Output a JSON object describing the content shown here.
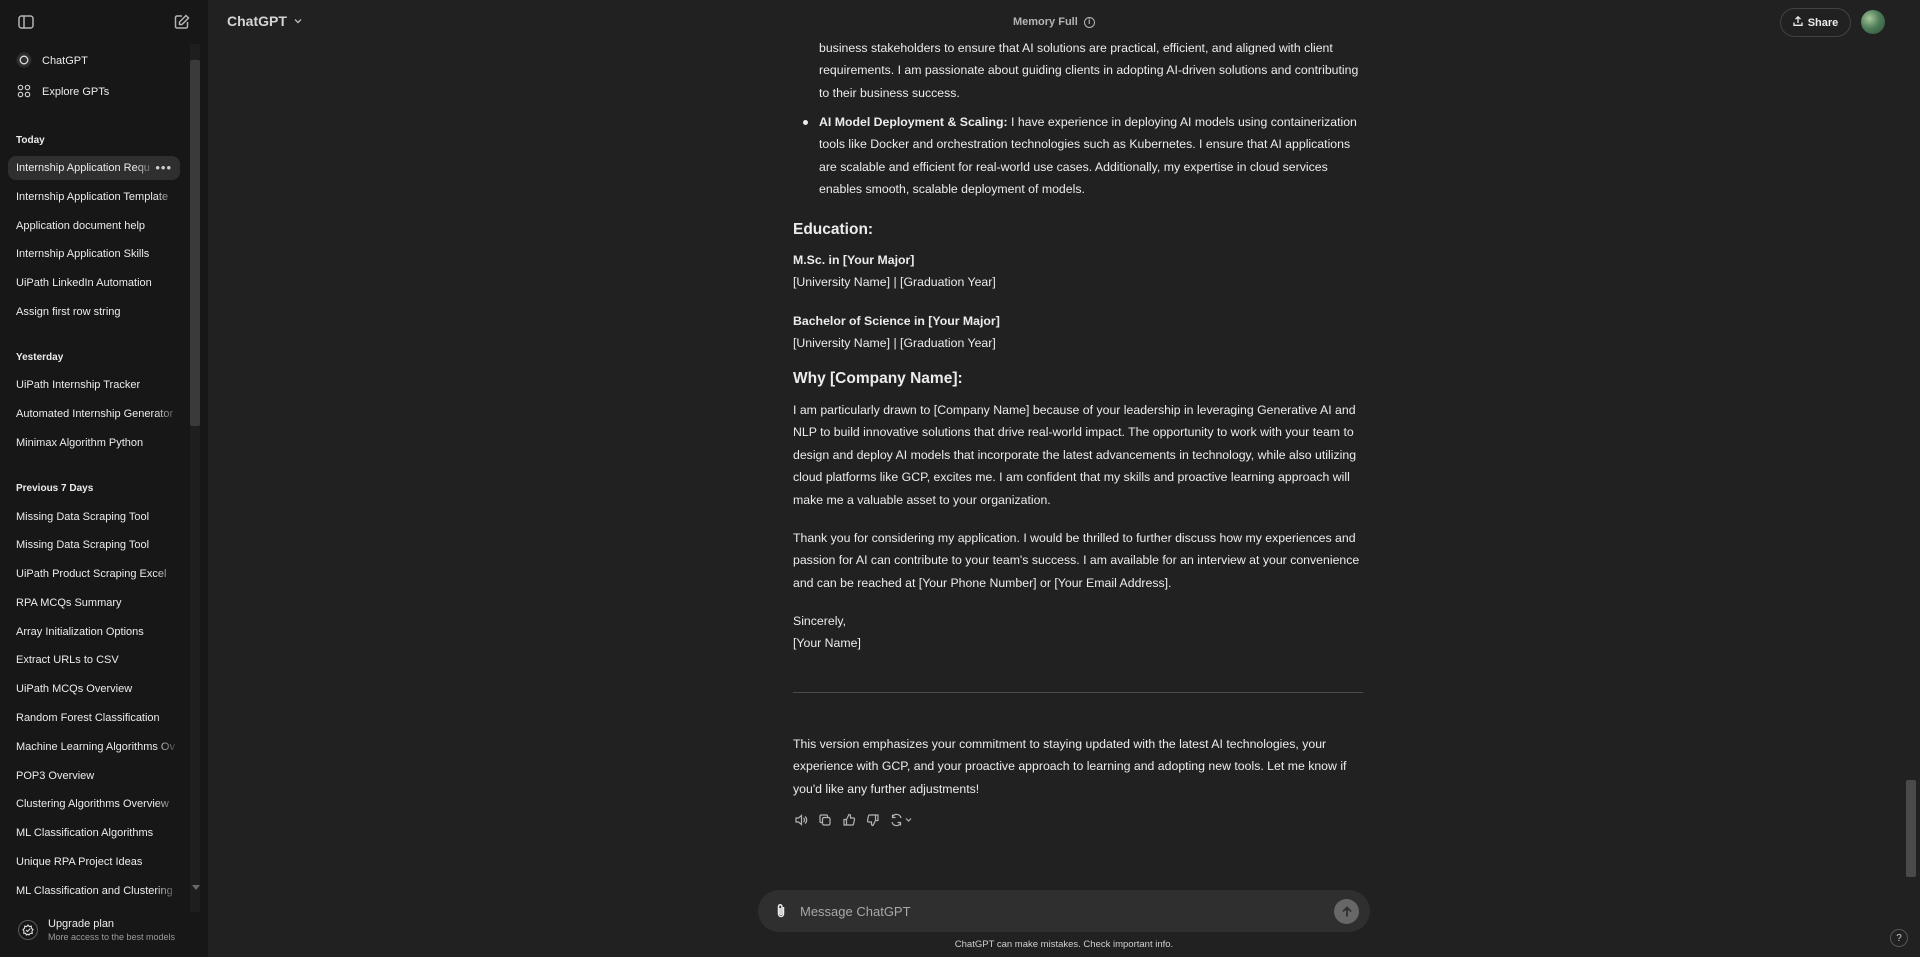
{
  "sidebar": {
    "top_links": [
      {
        "label": "ChatGPT",
        "icon": "openai-logo-icon"
      },
      {
        "label": "Explore GPTs",
        "icon": "grid-icon"
      }
    ],
    "sections": [
      {
        "title": "Today",
        "items": [
          "Internship Application Requ",
          "Internship Application Template",
          "Application document help",
          "Internship Application Skills",
          "UiPath LinkedIn Automation",
          "Assign first row string"
        ]
      },
      {
        "title": "Yesterday",
        "items": [
          "UiPath Internship Tracker",
          "Automated Internship Generator",
          "Minimax Algorithm Python"
        ]
      },
      {
        "title": "Previous 7 Days",
        "items": [
          "Missing Data Scraping Tool",
          "Missing Data Scraping Tool",
          "UiPath Product Scraping Excel",
          "RPA MCQs Summary",
          "Array Initialization Options",
          "Extract URLs to CSV",
          "UiPath MCQs Overview",
          "Random Forest Classification",
          "Machine Learning Algorithms Ov",
          "POP3 Overview",
          "Clustering Algorithms Overview",
          "ML Classification Algorithms",
          "Unique RPA Project Ideas",
          "ML Classification and Clustering"
        ]
      }
    ],
    "upgrade": {
      "title": "Upgrade plan",
      "subtitle": "More access to the best models"
    }
  },
  "header": {
    "model": "ChatGPT",
    "memory": "Memory Full",
    "share": "Share"
  },
  "message": {
    "bullet1_cont": "business stakeholders to ensure that AI solutions are practical, efficient, and aligned with client requirements. I am passionate about guiding clients in adopting AI-driven solutions and contributing to their business success.",
    "bullet2_title": "AI Model Deployment & Scaling:",
    "bullet2_text": " I have experience in deploying AI models using containerization tools like Docker and orchestration technologies such as Kubernetes. I ensure that AI applications are scalable and efficient for real-world use cases. Additionally, my expertise in cloud services enables smooth, scalable deployment of models.",
    "education_heading": "Education:",
    "edu1_degree": "M.Sc. in [Your Major]",
    "edu1_detail": "[University Name] | [Graduation Year]",
    "edu2_degree": "Bachelor of Science in [Your Major]",
    "edu2_detail": "[University Name] | [Graduation Year]",
    "why_heading": "Why [Company Name]:",
    "why_text": "I am particularly drawn to [Company Name] because of your leadership in leveraging Generative AI and NLP to build innovative solutions that drive real-world impact. The opportunity to work with your team to design and deploy AI models that incorporate the latest advancements in technology, while also utilizing cloud platforms like GCP, excites me. I am confident that my skills and proactive learning approach will make me a valuable asset to your organization.",
    "thanks_text": "Thank you for considering my application. I would be thrilled to further discuss how my experiences and passion for AI can contribute to your team's success. I am available for an interview at your convenience and can be reached at [Your Phone Number] or [Your Email Address].",
    "sign_off": "Sincerely,",
    "sign_name": "[Your Name]",
    "closing": "This version emphasizes your commitment to staying updated with the latest AI technologies, your experience with GCP, and your proactive approach to learning and adopting new tools. Let me know if you'd like any further adjustments!"
  },
  "composer": {
    "placeholder": "Message ChatGPT",
    "disclaimer": "ChatGPT can make mistakes. Check important info."
  },
  "colors": {
    "background": "#212121",
    "sidebar": "#171717",
    "text": "#ececec",
    "composer": "#2f2f2f"
  }
}
